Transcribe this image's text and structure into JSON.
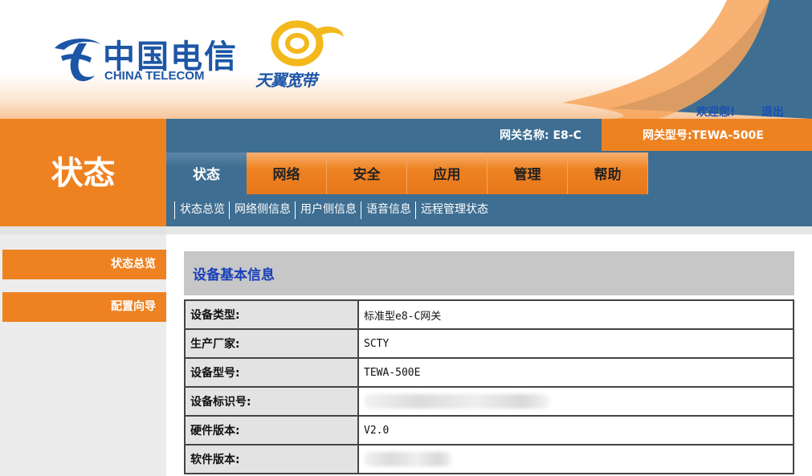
{
  "brand": {
    "telecom_cn": "中国电信",
    "telecom_en": "CHINA TELECOM",
    "tianyi_text": "天翼宽带"
  },
  "header": {
    "welcome": "欢迎您!",
    "logout": "退出"
  },
  "gateway": {
    "name_label": "网关名称:",
    "name_value": "E8-C",
    "model_label": "网关型号:",
    "model_value": "TEWA-500E"
  },
  "section_title": "状态",
  "tabs": [
    {
      "label": "状态",
      "active": true
    },
    {
      "label": "网络",
      "active": false
    },
    {
      "label": "安全",
      "active": false
    },
    {
      "label": "应用",
      "active": false
    },
    {
      "label": "管理",
      "active": false
    },
    {
      "label": "帮助",
      "active": false
    }
  ],
  "subnav": [
    "状态总览",
    "网络侧信息",
    "用户侧信息",
    "语音信息",
    "远程管理状态"
  ],
  "sidebar": {
    "items": [
      "状态总览",
      "配置向导"
    ]
  },
  "info": {
    "title": "设备基本信息",
    "rows": [
      {
        "key": "设备类型:",
        "value": "标准型e8-C网关"
      },
      {
        "key": "生产厂家:",
        "value": "SCTY"
      },
      {
        "key": "设备型号:",
        "value": "TEWA-500E"
      },
      {
        "key": "设备标识号:",
        "value": ""
      },
      {
        "key": "硬件版本:",
        "value": "V2.0"
      },
      {
        "key": "软件版本:",
        "value": ""
      }
    ]
  },
  "colors": {
    "orange": "#ee8221",
    "steel_blue": "#3e6e91",
    "link_blue": "#1a4fb0",
    "logo_blue": "#1d56a6"
  }
}
